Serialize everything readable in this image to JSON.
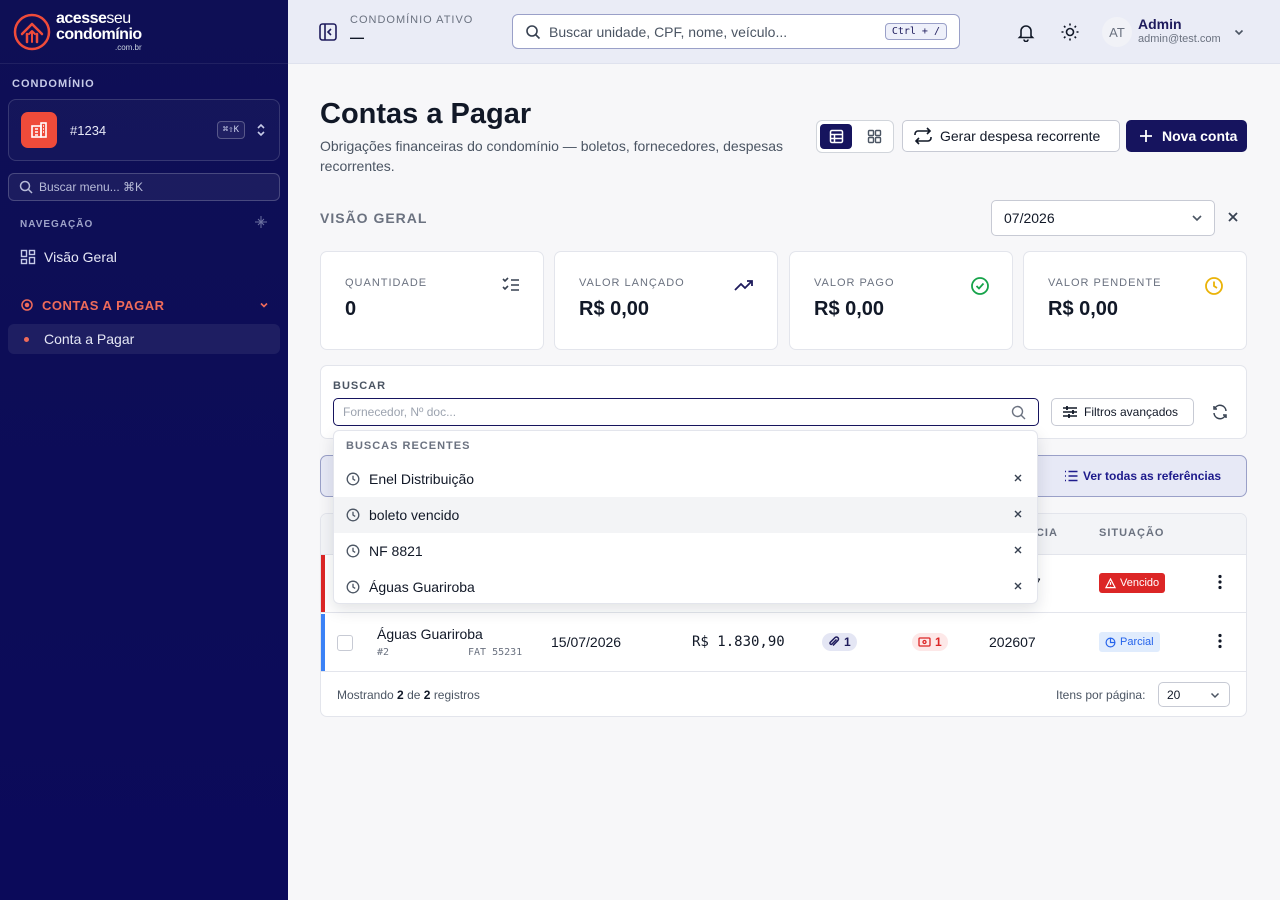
{
  "brand": {
    "line1_bold": "acesse",
    "line1_light": "seu",
    "line2": "condomínio",
    "domain": ".com.br"
  },
  "sidebar": {
    "section_title": "CONDOMÍNIO",
    "condo_id": "#1234",
    "condo_shortcut": "⌘⇧K",
    "search_placeholder": "Buscar menu... ⌘K",
    "nav_title": "NAVEGAÇÃO",
    "items": [
      {
        "label": "Visão Geral",
        "icon": "grid-icon"
      },
      {
        "label": "CONTAS A PAGAR",
        "icon": "dot-icon",
        "expanded": true
      },
      {
        "label": "Conta a Pagar",
        "active": true
      }
    ]
  },
  "topbar": {
    "active_condo_label": "CONDOMÍNIO ATIVO",
    "active_condo_value": "—",
    "search_placeholder": "Buscar unidade, CPF, nome, veículo...",
    "search_shortcut": "Ctrl + /",
    "avatar_initials": "AT",
    "user_name": "Admin",
    "user_email": "admin@test.com"
  },
  "page": {
    "title": "Contas a Pagar",
    "subtitle": "Obrigações financeiras do condomínio — boletos, fornecedores, despesas recorrentes.",
    "recurring_button": "Gerar despesa recorrente",
    "new_button": "Nova conta",
    "overview_title": "VISÃO GERAL",
    "month": "07/2026"
  },
  "stats": [
    {
      "label": "QUANTIDADE",
      "value": "0",
      "icon": "checklist-icon",
      "color": "#374151"
    },
    {
      "label": "VALOR LANÇADO",
      "value": "R$ 0,00",
      "icon": "trending-up-icon",
      "color": "#1e1b5c"
    },
    {
      "label": "VALOR PAGO",
      "value": "R$ 0,00",
      "icon": "check-circle-icon",
      "color": "#16a34a"
    },
    {
      "label": "VALOR PENDENTE",
      "value": "R$ 0,00",
      "icon": "clock-icon",
      "color": "#eab308"
    }
  ],
  "search": {
    "label": "BUSCAR",
    "placeholder": "Fornecedor, Nº doc...",
    "advanced_label": "Filtros avançados",
    "recent_title": "BUSCAS RECENTES",
    "recent": [
      "Enel Distribuição",
      "boleto vencido",
      "NF 8821",
      "Águas Guariroba"
    ]
  },
  "references": {
    "link_label": "Ver todas as referências"
  },
  "table": {
    "headers": {
      "reference_partial": "NCIA",
      "status": "SITUAÇÃO"
    },
    "rows": [
      {
        "supplier": "",
        "number": "",
        "doc": "",
        "due": "",
        "amount": "",
        "attachments": "",
        "boletos": "",
        "reference": "7",
        "status": "Vencido",
        "status_color": "#dc2626",
        "stripe": "#dc2626"
      },
      {
        "supplier": "Águas Guariroba",
        "number": "#2",
        "doc": "FAT 55231",
        "due": "15/07/2026",
        "amount": "R$ 1.830,90",
        "attachments": "1",
        "boletos": "1",
        "reference": "202607",
        "status": "Parcial",
        "status_color": "#2563eb",
        "stripe": "#3b82f6"
      }
    ],
    "footer": {
      "prefix": "Mostrando",
      "shown": "2",
      "of": "de",
      "total": "2",
      "suffix": "registros",
      "per_page_label": "Itens por página:",
      "per_page": "20"
    }
  }
}
